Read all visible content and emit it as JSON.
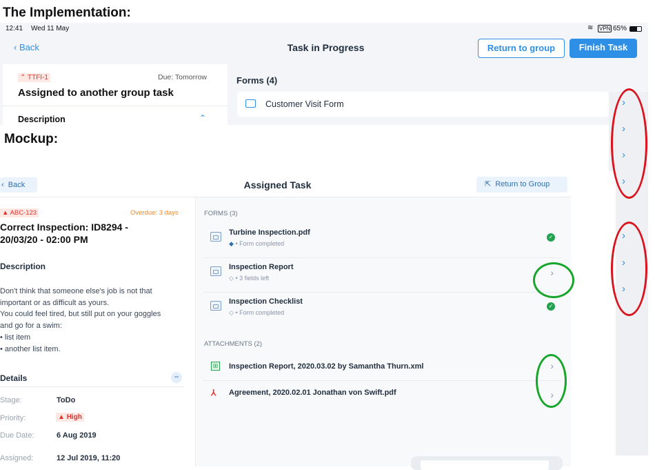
{
  "headings": {
    "implementation": "The Implementation:",
    "mockup": "Mockup:"
  },
  "implementation": {
    "status": {
      "time": "12:41",
      "date": "Wed 11 May",
      "vpn": "VPN",
      "battery": "65%"
    },
    "nav": {
      "back": "Back",
      "title": "Task in Progress",
      "return_btn": "Return to group",
      "finish_btn": "Finish Task"
    },
    "task": {
      "id": "TTFI-1",
      "due": "Due: Tomorrow",
      "title": "Assigned to another group task",
      "description_label": "Description"
    },
    "forms_header": "Forms (4)",
    "forms": [
      "Customer Visit Form"
    ]
  },
  "mockup": {
    "nav": {
      "back": "Back",
      "title": "Assigned Task",
      "return_btn": "Return to Group"
    },
    "task": {
      "id": "ABC-123",
      "overdue": "Overdue: 3 days",
      "title_line1": "Correct Inspection: ID8294 -",
      "title_line2": "20/03/20 - 02:00 PM",
      "description_label": "Description",
      "description_lines": [
        "Don't think that someone else's job is not that",
        "important or as difficult as yours.",
        "You could feel tired, but still put on your goggles",
        "and go for a swim:",
        "list item",
        "another list item."
      ],
      "details_label": "Details",
      "details": [
        {
          "label": "Stage:",
          "value": "ToDo"
        },
        {
          "label": "Priority:",
          "value": "High"
        },
        {
          "label": "Due Date:",
          "value": "6 Aug 2019"
        },
        {
          "label": "Assigned:",
          "value": "12 Jul 2019, 11:20"
        }
      ]
    },
    "forms_header": "FORMS (3)",
    "forms": [
      {
        "title": "Turbine Inspection.pdf",
        "sub": "• Form completed"
      },
      {
        "title": "Inspection Report",
        "sub": "• 3 fields left"
      },
      {
        "title": "Inspection Checklist",
        "sub": "• Form completed"
      }
    ],
    "attachments_header": "ATTACHMENTS (2)",
    "attachments": [
      {
        "title": "Inspection Report, 2020.03.02 by Samantha Thurn.xml"
      },
      {
        "title": "Agreement, 2020.02.01 Jonathan von Swift.pdf"
      }
    ]
  },
  "colors": {
    "accent": "#2d8fe6",
    "red_annotation": "#d9141e",
    "green_annotation": "#17a62b",
    "priority_red": "#e2312f",
    "complete_green": "#22a24f"
  }
}
